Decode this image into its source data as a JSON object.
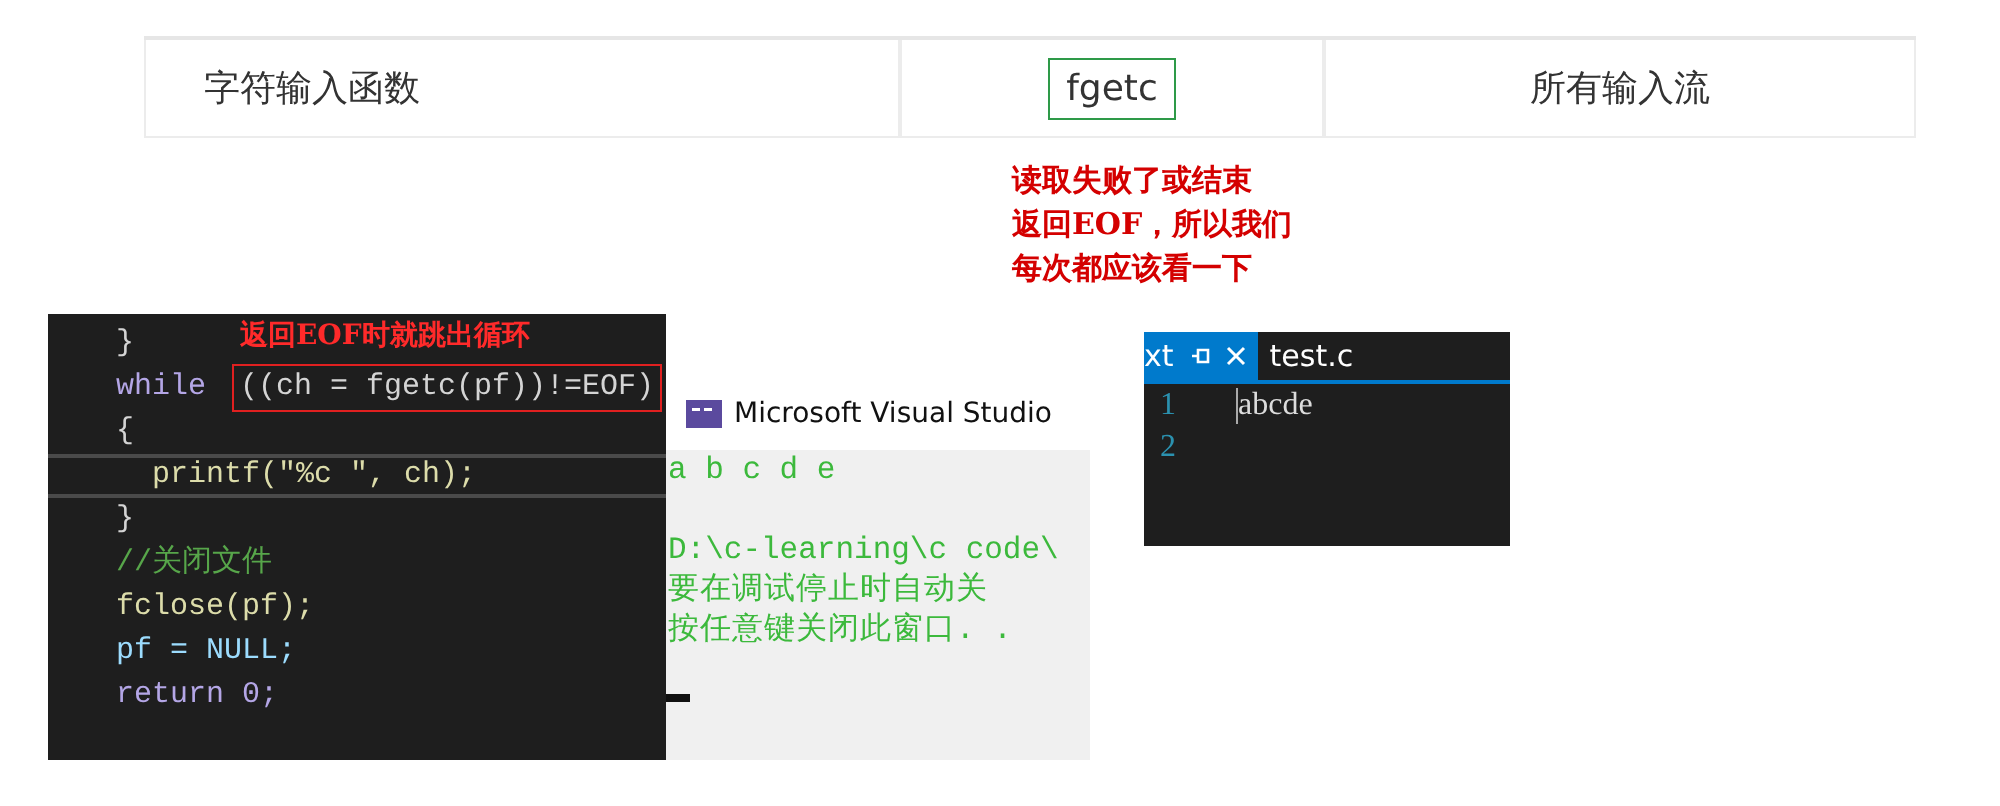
{
  "table": {
    "rows": [
      {
        "cells": [
          {
            "text": "字符输入函数",
            "highlighted": false
          },
          {
            "text": "fgetc",
            "highlighted": true
          },
          {
            "text": "所有输入流",
            "highlighted": false
          }
        ]
      }
    ]
  },
  "note": {
    "lines": [
      "读取失败了或结束",
      "返回EOF，所以我们",
      "每次都应该看一下"
    ]
  },
  "code_screenshot": {
    "callout": "返回EOF时就跳出循环",
    "lines": [
      {
        "current": false,
        "segments": [
          {
            "text": "}",
            "kind": "plain",
            "boxed": false
          }
        ]
      },
      {
        "current": false,
        "segments": [
          {
            "text": "while ",
            "kind": "keyword",
            "boxed": false
          },
          {
            "text": "((ch = fgetc(pf))!=EOF)",
            "kind": "plain",
            "boxed": true
          }
        ]
      },
      {
        "current": false,
        "segments": [
          {
            "text": "{",
            "kind": "plain",
            "boxed": false
          }
        ]
      },
      {
        "current": true,
        "segments": [
          {
            "text": "  printf(″%c ″, ch);",
            "kind": "func",
            "boxed": false
          }
        ]
      },
      {
        "current": false,
        "segments": [
          {
            "text": "}",
            "kind": "plain",
            "boxed": false
          }
        ]
      },
      {
        "current": false,
        "segments": [
          {
            "text": "//关闭文件",
            "kind": "comment",
            "boxed": false
          }
        ]
      },
      {
        "current": false,
        "segments": [
          {
            "text": "fclose(pf);",
            "kind": "func",
            "boxed": false
          }
        ]
      },
      {
        "current": false,
        "segments": [
          {
            "text": "pf = NULL;",
            "kind": "ident",
            "boxed": false
          }
        ]
      },
      {
        "current": false,
        "segments": [
          {
            "text": "return 0;",
            "kind": "keyword",
            "boxed": false
          }
        ]
      }
    ]
  },
  "console": {
    "title": "Microsoft Visual Studio",
    "blocks": [
      [
        "a b c d e"
      ],
      [
        "D:\\c-learning\\c code\\",
        "要在调试停止时自动关",
        "按任意键关闭此窗口. ."
      ]
    ]
  },
  "editor": {
    "tabs": [
      {
        "label": "xt",
        "selected": true
      },
      {
        "label": "test.c",
        "selected": false
      }
    ],
    "lines": [
      {
        "number": "1",
        "text": "abcde"
      },
      {
        "number": "2"
      }
    ]
  }
}
